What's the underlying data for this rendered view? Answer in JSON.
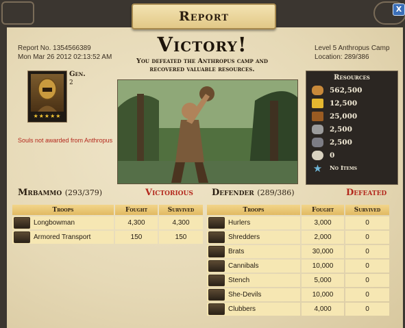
{
  "window": {
    "title": "Report",
    "close_label": "X"
  },
  "report": {
    "number": "Report No. 1354566389",
    "date": "Mon Mar 26 2012 02:13:52 AM",
    "headline": "Victory!",
    "subtitle": "You defeated the Anthropus camp and recovered valuable resources.",
    "location_name": "Level 5 Anthropus Camp",
    "location_coords": "Location: 289/386"
  },
  "general": {
    "label": "Gen.",
    "level": "2",
    "stars": "★★★★★",
    "souls_note": "Souls not awarded from Anthropus"
  },
  "resources": {
    "title": "Resources",
    "items": [
      {
        "icon": "bread-icon",
        "value": "562,500",
        "color": "#c8893a"
      },
      {
        "icon": "gold-coins-icon",
        "value": "12,500",
        "color": "#e4b730"
      },
      {
        "icon": "wood-icon",
        "value": "25,000",
        "color": "#9a5b22"
      },
      {
        "icon": "stone-icon",
        "value": "2,500",
        "color": "#9c9c9c"
      },
      {
        "icon": "iron-ore-icon",
        "value": "2,500",
        "color": "#7d7d85"
      },
      {
        "icon": "skull-icon",
        "value": "0",
        "color": "#d9d2c0"
      },
      {
        "icon": "star-item-icon",
        "value": "No Items",
        "color": "#6fb7d8"
      }
    ]
  },
  "attacker": {
    "name": "Mrbammo",
    "count": "(293/379)",
    "result": "Victorious",
    "headers": [
      "Troops",
      "Fought",
      "Survived"
    ],
    "rows": [
      {
        "icon": "longbowman-icon",
        "name": "Longbowman",
        "fought": "4,300",
        "survived": "4,300"
      },
      {
        "icon": "armored-transport-icon",
        "name": "Armored Transport",
        "fought": "150",
        "survived": "150"
      }
    ]
  },
  "defender": {
    "name": "Defender",
    "count": "(289/386)",
    "result": "Defeated",
    "headers": [
      "Troops",
      "Fought",
      "Survived"
    ],
    "rows": [
      {
        "icon": "hurlers-icon",
        "name": "Hurlers",
        "fought": "3,000",
        "survived": "0"
      },
      {
        "icon": "shredders-icon",
        "name": "Shredders",
        "fought": "2,000",
        "survived": "0"
      },
      {
        "icon": "brats-icon",
        "name": "Brats",
        "fought": "30,000",
        "survived": "0"
      },
      {
        "icon": "cannibals-icon",
        "name": "Cannibals",
        "fought": "10,000",
        "survived": "0"
      },
      {
        "icon": "stench-icon",
        "name": "Stench",
        "fought": "5,000",
        "survived": "0"
      },
      {
        "icon": "she-devils-icon",
        "name": "She-Devils",
        "fought": "10,000",
        "survived": "0"
      },
      {
        "icon": "clubbers-icon",
        "name": "Clubbers",
        "fought": "4,000",
        "survived": "0"
      }
    ]
  }
}
